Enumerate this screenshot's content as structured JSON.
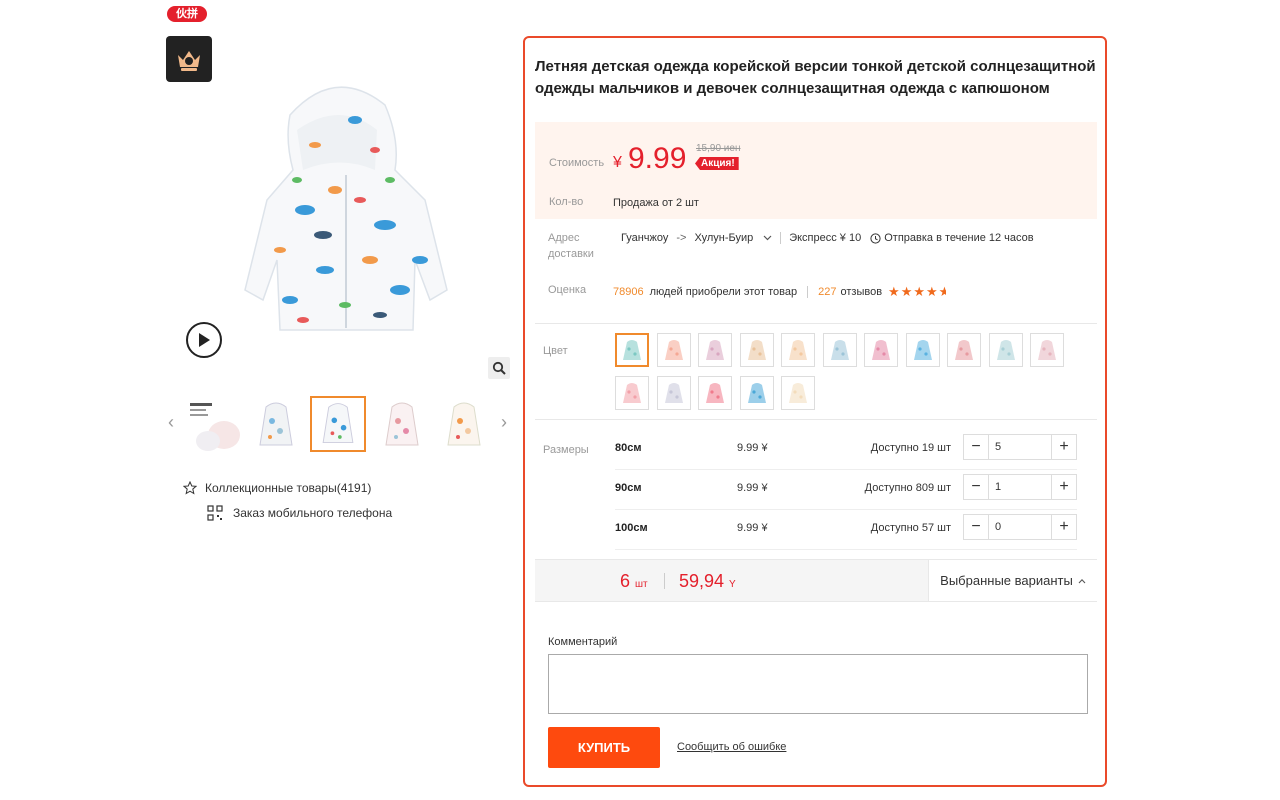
{
  "badge": "伙拼",
  "product": {
    "title": "Летняя детская одежда корейской версии тонкой детской солнцезащитной одежды мальчиков и девочек солнцезащитная одежда с капюшоном",
    "price_label": "Стоимость",
    "currency": "¥",
    "price": "9.99",
    "old_price": "15,90 иен",
    "promo": "Акция!",
    "qty_label": "Кол-во",
    "qty_text": "Продажа от 2  шт"
  },
  "gallery": {
    "thumb_count": 5,
    "active_thumb": 2
  },
  "left_actions": {
    "favorites": "Коллекционные товары(4191)",
    "mobile_order": "Заказ мобильного телефона"
  },
  "shipping": {
    "label": "Адрес доставки",
    "from": "Гуанчжоу",
    "arrow": "->",
    "to": "Хулун-Буир",
    "express": "Экспресс ¥ 10",
    "dispatch": "Отправка в течение 12 часов"
  },
  "rating": {
    "label": "Оценка",
    "buyers_count": "78906",
    "buyers_text": "людей приобрели этот товар",
    "reviews_count": "227",
    "reviews_text": "отзывов",
    "stars": 4.5
  },
  "colors": {
    "label": "Цвет",
    "selected_index": 0,
    "swatches": [
      "#7cc8c2",
      "#f5a894",
      "#d9a6c0",
      "#e9c29a",
      "#f3c9a0",
      "#9cc4d8",
      "#e58aa8",
      "#5ab2e0",
      "#e79aa0",
      "#a8cfd6",
      "#e6b4bd",
      "#f2a0a8",
      "#c6c6d8",
      "#f07a8c",
      "#4aa8d8",
      "#f3dcbb"
    ]
  },
  "sizes": {
    "label": "Размеры",
    "rows": [
      {
        "name": "80см",
        "price": "9.99  ¥",
        "avail": "Доступно 19 шт",
        "qty": "5"
      },
      {
        "name": "90см",
        "price": "9.99  ¥",
        "avail": "Доступно 809 шт",
        "qty": "1"
      },
      {
        "name": "100см",
        "price": "9.99  ¥",
        "avail": "Доступно 57 шт",
        "qty": "0"
      }
    ]
  },
  "total": {
    "qty": "6",
    "qty_unit": "шт",
    "sum": "59,94",
    "sum_unit": "Y",
    "selected_variants": "Выбранные варианты"
  },
  "comment": {
    "label": "Комментарий",
    "value": ""
  },
  "buy_label": "КУПИТЬ",
  "report_label": "Сообщить об ошибке",
  "accent_color": "#fe4a0e",
  "price_color": "#e4202c"
}
